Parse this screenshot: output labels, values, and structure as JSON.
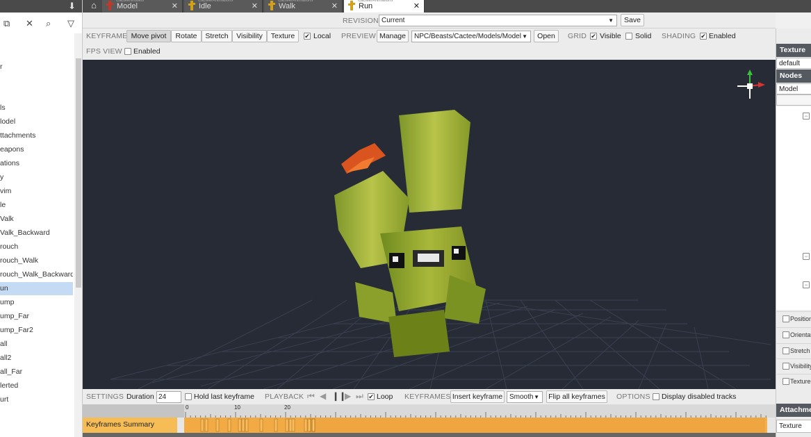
{
  "left_panel": {
    "tree_items": [
      {
        "label": "r",
        "selected": false
      },
      {
        "label": "ls",
        "selected": false
      },
      {
        "label": "lodel",
        "selected": false
      },
      {
        "label": "ttachments",
        "selected": false
      },
      {
        "label": "eapons",
        "selected": false
      },
      {
        "label": "ations",
        "selected": false
      },
      {
        "label": "y",
        "selected": false
      },
      {
        "label": "vim",
        "selected": false
      },
      {
        "label": "le",
        "selected": false
      },
      {
        "label": "Valk",
        "selected": false
      },
      {
        "label": "Valk_Backward",
        "selected": false
      },
      {
        "label": "rouch",
        "selected": false
      },
      {
        "label": "rouch_Walk",
        "selected": false
      },
      {
        "label": "rouch_Walk_Backward",
        "selected": false
      },
      {
        "label": "un",
        "selected": true
      },
      {
        "label": "ump",
        "selected": false
      },
      {
        "label": "ump_Far",
        "selected": false
      },
      {
        "label": "ump_Far2",
        "selected": false
      },
      {
        "label": "all",
        "selected": false
      },
      {
        "label": "all2",
        "selected": false
      },
      {
        "label": "all_Far",
        "selected": false
      },
      {
        "label": "lerted",
        "selected": false
      },
      {
        "label": "urt",
        "selected": false
      }
    ]
  },
  "tabs": [
    {
      "path": "Cactee/Models",
      "name": "Model",
      "icon_color": "#c0392b",
      "active": false
    },
    {
      "path": "Cactee/Animations",
      "name": "Idle",
      "icon_color": "#d4a017",
      "active": false
    },
    {
      "path": "Cactee/Animations",
      "name": "Walk",
      "icon_color": "#d4a017",
      "active": false
    },
    {
      "path": "Cactee/Animations",
      "name": "Run",
      "icon_color": "#d4a017",
      "active": true
    }
  ],
  "revision": {
    "label": "REVISION",
    "value": "Current",
    "save": "Save"
  },
  "keyframe": {
    "label": "KEYFRAME",
    "buttons": [
      "Move pivot",
      "Rotate",
      "Stretch",
      "Visibility",
      "Texture"
    ],
    "local": "Local",
    "preview_label": "PREVIEW",
    "manage": "Manage",
    "model_path": "NPC/Beasts/Cactee/Models/Model",
    "open": "Open",
    "grid_label": "GRID",
    "visible": "Visible",
    "solid": "Solid",
    "shading_label": "SHADING",
    "enabled": "Enabled"
  },
  "fps": {
    "label": "FPS VIEW",
    "enabled": "Enabled"
  },
  "right_panel": {
    "texture_header": "Texture",
    "texture_value": "default",
    "nodes_header": "Nodes",
    "nodes_value": "Model",
    "checkboxes": [
      "Position",
      "Orientation",
      "Stretch",
      "Visibility",
      "Texture"
    ],
    "attachments_header": "Attachments",
    "attachments_value": "Texture"
  },
  "settings": {
    "label": "SETTINGS",
    "duration_label": "Duration",
    "duration_value": "24",
    "hold_last": "Hold last keyframe",
    "playback_label": "PLAYBACK",
    "loop": "Loop",
    "keyframes_label": "KEYFRAMES",
    "insert_keyframe": "Insert keyframe",
    "interp": "Smooth",
    "flip_all": "Flip all keyframes",
    "options_label": "OPTIONS",
    "display_disabled": "Display disabled tracks"
  },
  "timeline": {
    "ticks": [
      "0",
      "10",
      "20"
    ],
    "summary_label": "Keyframes Summary"
  }
}
